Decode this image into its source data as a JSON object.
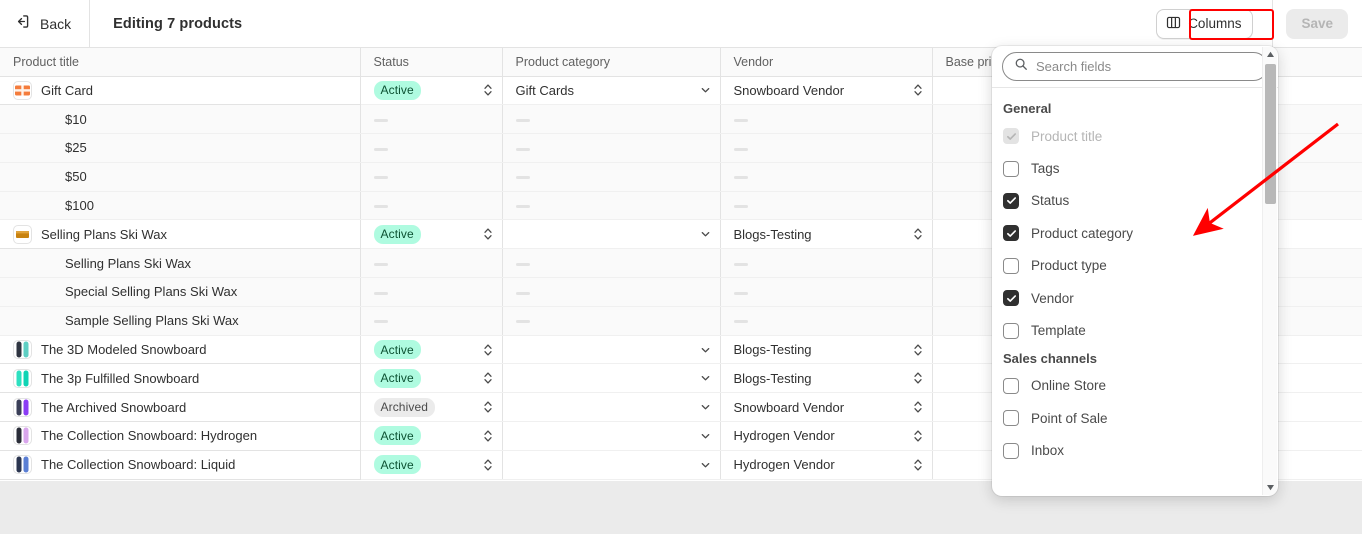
{
  "topbar": {
    "back_label": "Back",
    "back_icon": "exit-arrow-icon",
    "title": "Editing 7 products",
    "columns_label": "Columns",
    "columns_icon": "columns-layout-icon",
    "save_label": "Save",
    "highlight_color": "#ff0000"
  },
  "table": {
    "columns": [
      {
        "key": "title",
        "label": "Product title"
      },
      {
        "key": "status",
        "label": "Status"
      },
      {
        "key": "cat",
        "label": "Product category"
      },
      {
        "key": "vendor",
        "label": "Vendor"
      },
      {
        "key": "price",
        "label": "Base pri"
      }
    ],
    "empty_marker": "—",
    "rows": [
      {
        "type": "parent",
        "title": "Gift Card",
        "thumb": "giftcard",
        "status": "Active",
        "status_kind": "active",
        "category": "Gift Cards",
        "vendor": "Snowboard Vendor"
      },
      {
        "type": "variant",
        "title": "$10",
        "thumb": "",
        "status": "",
        "status_kind": "",
        "category": "",
        "vendor": ""
      },
      {
        "type": "variant",
        "title": "$25",
        "thumb": "",
        "status": "",
        "status_kind": "",
        "category": "",
        "vendor": ""
      },
      {
        "type": "variant",
        "title": "$50",
        "thumb": "",
        "status": "",
        "status_kind": "",
        "category": "",
        "vendor": ""
      },
      {
        "type": "variant",
        "title": "$100",
        "thumb": "",
        "status": "",
        "status_kind": "",
        "category": "",
        "vendor": ""
      },
      {
        "type": "parent",
        "title": "Selling Plans Ski Wax",
        "thumb": "skiwax",
        "status": "Active",
        "status_kind": "active",
        "category": "",
        "vendor": "Blogs-Testing"
      },
      {
        "type": "variant",
        "title": "Selling Plans Ski Wax",
        "thumb": "",
        "status": "",
        "status_kind": "",
        "category": "",
        "vendor": ""
      },
      {
        "type": "variant",
        "title": "Special Selling Plans Ski Wax",
        "thumb": "",
        "status": "",
        "status_kind": "",
        "category": "",
        "vendor": ""
      },
      {
        "type": "variant",
        "title": "Sample Selling Plans Ski Wax",
        "thumb": "",
        "status": "",
        "status_kind": "",
        "category": "",
        "vendor": ""
      },
      {
        "type": "parent",
        "title": "The 3D Modeled Snowboard",
        "thumb": "board-teal",
        "status": "Active",
        "status_kind": "active",
        "category": "",
        "vendor": "Blogs-Testing"
      },
      {
        "type": "parent",
        "title": "The 3p Fulfilled Snowboard",
        "thumb": "board-cyan",
        "status": "Active",
        "status_kind": "active",
        "category": "",
        "vendor": "Blogs-Testing"
      },
      {
        "type": "parent",
        "title": "The Archived Snowboard",
        "thumb": "board-purple",
        "status": "Archived",
        "status_kind": "archived",
        "category": "",
        "vendor": "Snowboard Vendor"
      },
      {
        "type": "parent",
        "title": "The Collection Snowboard: Hydrogen",
        "thumb": "board-lilac",
        "status": "Active",
        "status_kind": "active",
        "category": "",
        "vendor": "Hydrogen Vendor"
      },
      {
        "type": "parent",
        "title": "The Collection Snowboard: Liquid",
        "thumb": "board-blue",
        "status": "Active",
        "status_kind": "active",
        "category": "",
        "vendor": "Hydrogen Vendor"
      }
    ]
  },
  "columns_popover": {
    "search": {
      "placeholder": "Search fields",
      "value": "",
      "icon": "search-icon"
    },
    "groups": [
      {
        "title": "General",
        "items": [
          {
            "label": "Product title",
            "checked": true,
            "disabled": true
          },
          {
            "label": "Tags",
            "checked": false,
            "disabled": false
          },
          {
            "label": "Status",
            "checked": true,
            "disabled": false
          },
          {
            "label": "Product category",
            "checked": true,
            "disabled": false
          },
          {
            "label": "Product type",
            "checked": false,
            "disabled": false
          },
          {
            "label": "Vendor",
            "checked": true,
            "disabled": false
          },
          {
            "label": "Template",
            "checked": false,
            "disabled": false
          }
        ]
      },
      {
        "title": "Sales channels",
        "items": [
          {
            "label": "Online Store",
            "checked": false,
            "disabled": false
          },
          {
            "label": "Point of Sale",
            "checked": false,
            "disabled": false
          },
          {
            "label": "Inbox",
            "checked": false,
            "disabled": false
          }
        ]
      }
    ],
    "scrollbar": {
      "up_icon": "triangle-up-icon",
      "down_icon": "triangle-down-icon"
    }
  },
  "annotation": {
    "arrow_color": "#ff0000",
    "arrow_from": "1338,124",
    "arrow_to": "1192,236"
  }
}
